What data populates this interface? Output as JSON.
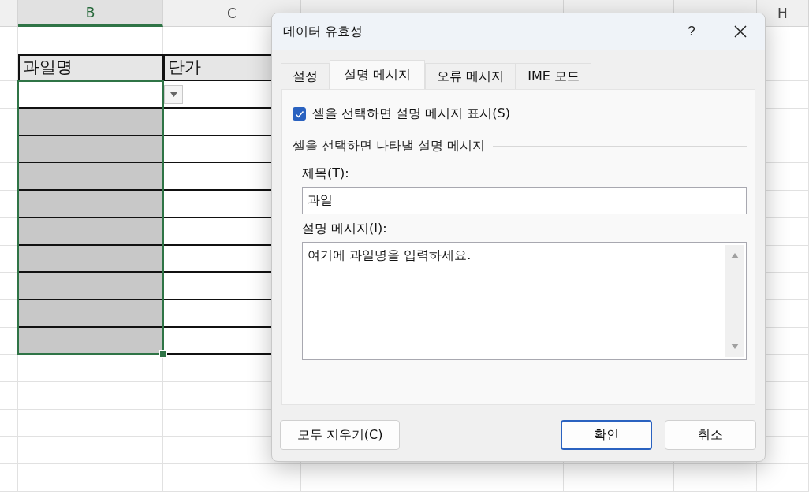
{
  "sheet": {
    "columns": [
      {
        "label": "B",
        "selected": true
      },
      {
        "label": "C",
        "selected": false
      },
      {
        "label": "H",
        "selected": false
      }
    ],
    "header_cells": [
      "과일명",
      "단가"
    ],
    "rows": [
      {
        "shaded": false
      },
      {
        "shaded": true
      },
      {
        "shaded": true
      },
      {
        "shaded": true
      },
      {
        "shaded": true
      },
      {
        "shaded": true
      },
      {
        "shaded": true
      },
      {
        "shaded": true
      },
      {
        "shaded": true
      },
      {
        "shaded": true
      }
    ]
  },
  "dialog": {
    "title": "데이터 유효성",
    "help": "?",
    "tabs": [
      {
        "label": "설정",
        "selected": false
      },
      {
        "label": "설명 메시지",
        "selected": true
      },
      {
        "label": "오류 메시지",
        "selected": false
      },
      {
        "label": "IME 모드",
        "selected": false
      }
    ],
    "checkbox": {
      "label": "셀을 선택하면 설명 메시지 표시(S)",
      "checked": true
    },
    "group_label": "셀을 선택하면 나타낼 설명 메시지",
    "title_field": {
      "label": "제목(T):",
      "value": "과일"
    },
    "message_field": {
      "label": "설명 메시지(I):",
      "value": "여기에 과일명을 입력하세요."
    },
    "buttons": [
      {
        "label": "모두 지우기(C)",
        "kind": "left"
      },
      {
        "label": "확인",
        "kind": "default"
      },
      {
        "label": "취소",
        "kind": "normal"
      }
    ]
  }
}
